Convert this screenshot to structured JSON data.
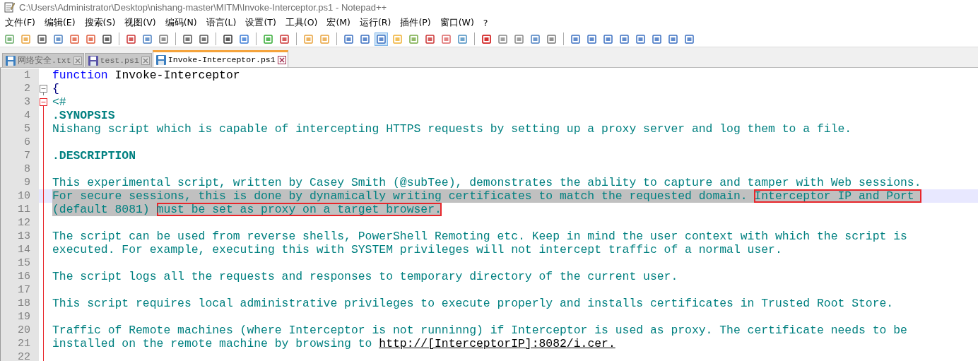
{
  "window": {
    "title": "C:\\Users\\Administrator\\Desktop\\nishang-master\\MITM\\Invoke-Interceptor.ps1 - Notepad++"
  },
  "menu": [
    "文件(F)",
    "编辑(E)",
    "搜索(S)",
    "视图(V)",
    "编码(N)",
    "语言(L)",
    "设置(T)",
    "工具(O)",
    "宏(M)",
    "运行(R)",
    "插件(P)",
    "窗口(W)",
    "?"
  ],
  "tabs": [
    {
      "label": "网络安全.txt",
      "selected": false,
      "color": "#3c7fc0"
    },
    {
      "label": "test.ps1",
      "selected": false,
      "color": "#5a55a8"
    },
    {
      "label": "Invoke-Interceptor.ps1",
      "selected": true,
      "color": "#3c7fc0"
    }
  ],
  "editor": {
    "lines": [
      {
        "number": "1",
        "fold_start": false,
        "in_block": false,
        "current": false,
        "segments": [
          {
            "kind": "keyword",
            "text": "function"
          },
          {
            "kind": "plain",
            "text": " Invoke-Interceptor"
          }
        ]
      },
      {
        "number": "2",
        "fold_start": true,
        "in_block": false,
        "current": false,
        "segments": [
          {
            "kind": "brace",
            "text": "{"
          }
        ]
      },
      {
        "number": "3",
        "fold_start": true,
        "in_block": true,
        "current": false,
        "segments": [
          {
            "kind": "comment",
            "text": "<#"
          }
        ]
      },
      {
        "number": "4",
        "fold_start": false,
        "in_block": true,
        "current": false,
        "segments": [
          {
            "kind": "comment-bold",
            "text": ".SYNOPSIS"
          }
        ]
      },
      {
        "number": "5",
        "fold_start": false,
        "in_block": true,
        "current": false,
        "segments": [
          {
            "kind": "comment",
            "text": "Nishang script which is capable of intercepting HTTPS requests by setting up a proxy server and log them to a file."
          }
        ]
      },
      {
        "number": "6",
        "fold_start": false,
        "in_block": true,
        "current": false
      },
      {
        "number": "7",
        "fold_start": false,
        "in_block": true,
        "current": false,
        "segments": [
          {
            "kind": "comment-bold",
            "text": ".DESCRIPTION"
          }
        ]
      },
      {
        "number": "8",
        "fold_start": false,
        "in_block": true,
        "current": false
      },
      {
        "number": "9",
        "fold_start": false,
        "in_block": true,
        "current": false,
        "segments": [
          {
            "kind": "comment",
            "text": "This experimental script, written by Casey Smith (@subTee), demonstrates the ability to capture and tamper with Web sessions."
          }
        ]
      },
      {
        "number": "10",
        "fold_start": false,
        "in_block": true,
        "current": true,
        "segments": [
          {
            "kind": "comment",
            "selected": true,
            "text": "For secure sessions, this is done by dynamically writing certificates to match the requested domain. "
          },
          {
            "kind": "comment",
            "selected": true,
            "boxed": true,
            "text": "Interceptor IP and Port "
          }
        ]
      },
      {
        "number": "11",
        "fold_start": false,
        "in_block": true,
        "current": false,
        "segments": [
          {
            "kind": "comment",
            "selected": true,
            "text": "(default 8081) "
          },
          {
            "kind": "comment",
            "selected": true,
            "boxed": true,
            "text": "must be set as proxy on a target browser."
          }
        ]
      },
      {
        "number": "12",
        "fold_start": false,
        "in_block": true,
        "current": false
      },
      {
        "number": "13",
        "fold_start": false,
        "in_block": true,
        "current": false,
        "segments": [
          {
            "kind": "comment",
            "text": "The script can be used from reverse shells, PowerShell Remoting etc. Keep in mind the user context with which the script is"
          }
        ]
      },
      {
        "number": "14",
        "fold_start": false,
        "in_block": true,
        "current": false,
        "segments": [
          {
            "kind": "comment",
            "text": "executed. For example, executing this with SYSTEM privileges will not intercept traffic of a normal user."
          }
        ]
      },
      {
        "number": "15",
        "fold_start": false,
        "in_block": true,
        "current": false
      },
      {
        "number": "16",
        "fold_start": false,
        "in_block": true,
        "current": false,
        "segments": [
          {
            "kind": "comment",
            "text": "The script logs all the requests and responses to temporary directory of the current user."
          }
        ]
      },
      {
        "number": "17",
        "fold_start": false,
        "in_block": true,
        "current": false
      },
      {
        "number": "18",
        "fold_start": false,
        "in_block": true,
        "current": false,
        "segments": [
          {
            "kind": "comment",
            "text": "This script requires local administrative privileges to execute properly and installs certificates in Trusted Root Store."
          }
        ]
      },
      {
        "number": "19",
        "fold_start": false,
        "in_block": true,
        "current": false
      },
      {
        "number": "20",
        "fold_start": false,
        "in_block": true,
        "current": false,
        "segments": [
          {
            "kind": "comment",
            "text": "Traffic of Remote machines (where Interceptor is not runninng) if Interceptor is used as proxy. The certificate needs to be"
          }
        ]
      },
      {
        "number": "21",
        "fold_start": false,
        "in_block": true,
        "current": false,
        "segments": [
          {
            "kind": "comment",
            "text": "installed on the remote machine by browsing to "
          },
          {
            "kind": "link",
            "text": "http://[InterceptorIP]:8082/i.cer."
          }
        ]
      },
      {
        "number": "22",
        "fold_start": false,
        "in_block": true,
        "current": false
      }
    ]
  }
}
